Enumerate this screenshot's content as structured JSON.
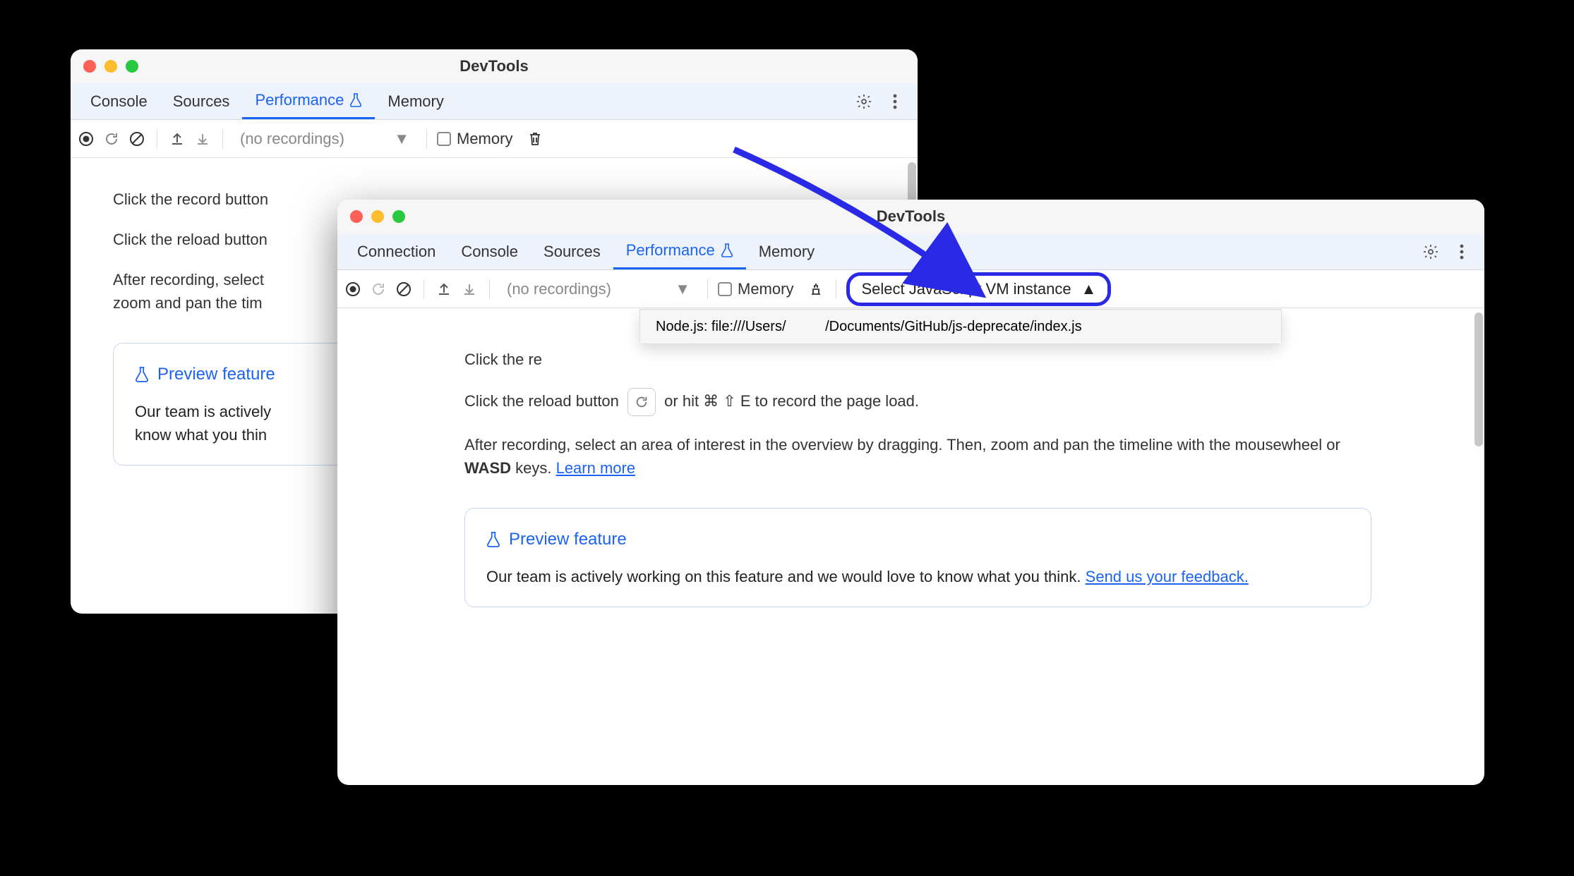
{
  "window_back": {
    "title": "DevTools",
    "tabs": [
      "Console",
      "Sources",
      "Performance",
      "Memory"
    ],
    "active_tab": "Performance",
    "toolbar": {
      "recordings_placeholder": "(no recordings)",
      "memory_label": "Memory"
    },
    "body": {
      "line1_prefix": "Click the record button",
      "line2_prefix": "Click the reload button",
      "line3_prefix": "After recording, select",
      "line3_cont": "zoom and pan the tim",
      "preview_label": "Preview feature",
      "preview_text_line1": "Our team is actively",
      "preview_text_line2": "know what you thin"
    }
  },
  "window_front": {
    "title": "DevTools",
    "tabs": [
      "Connection",
      "Console",
      "Sources",
      "Performance",
      "Memory"
    ],
    "active_tab": "Performance",
    "toolbar": {
      "recordings_placeholder": "(no recordings)",
      "memory_label": "Memory",
      "vm_select_label": "Select JavaScript VM instance"
    },
    "dropdown_item": "Node.js: file:///Users/          /Documents/GitHub/js-deprecate/index.js",
    "body": {
      "line1_prefix": "Click the re",
      "line2_prefix": "Click the reload button",
      "line2_suffix": "or hit ⌘ ⇧ E to record the page load.",
      "line3": "After recording, select an area of interest in the overview by dragging. Then, zoom and pan the timeline with the mousewheel or ",
      "wasd": "WASD",
      "line3_suffix": " keys. ",
      "learn_more": "Learn more",
      "preview_label": "Preview feature",
      "preview_text": "Our team is actively working on this feature and we would love to know what you think. ",
      "feedback_link": "Send us your feedback."
    }
  }
}
